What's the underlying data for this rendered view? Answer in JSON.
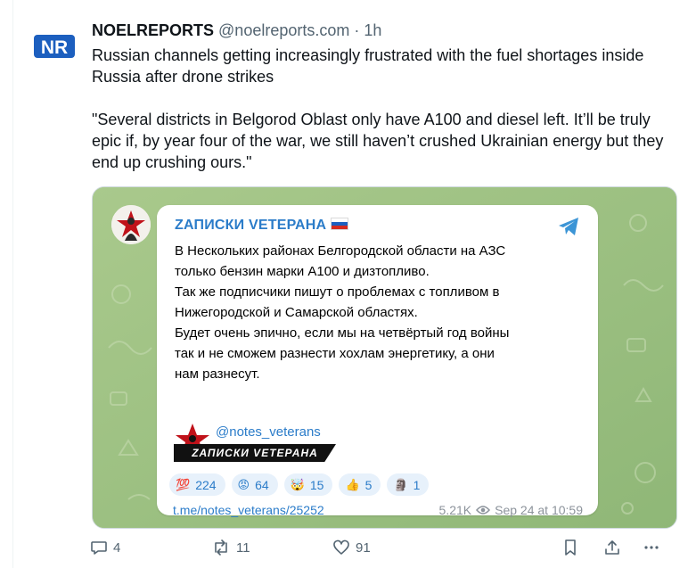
{
  "author": {
    "avatar_text": "NR",
    "name": "NOELREPORTS",
    "handle": "@noelreports.com",
    "separator": "·",
    "time": "1h"
  },
  "tweet": {
    "paragraph1": "Russian channels getting increasingly frustrated with the fuel shortages inside Russia after drone strikes",
    "paragraph2": "\"Several districts in Belgorod Oblast only have A100 and diesel left. It’ll be truly epic if, by year four of the war, we still haven’t crushed Ukrainian energy but they end up crushing ours.\""
  },
  "telegram": {
    "channel_name": "ZАПИСКИ VЕТЕРАНА",
    "text": "В Нескольких районах Белгородской области на АЗС\nтолько бензин марки А100 и дизтопливо.\nТак же подписчики пишут о проблемах с топливом в\nНижегородской и Самарской областях.\nБудет очень эпично, если мы на четвёртый год войны\nтак и не сможем разнести хохлам энергетику, а они\nнам разнесут.",
    "signature_handle": "@notes_veterans",
    "signature_banner": "ZАПИСКИ VЕТЕРАНА",
    "reactions": [
      {
        "emoji": "💯",
        "icon": "hundred-points-icon",
        "count": "224"
      },
      {
        "emoji": "😡",
        "icon": "angry-face-icon",
        "count": "64"
      },
      {
        "emoji": "🤯",
        "icon": "exploding-head-icon",
        "count": "15"
      },
      {
        "emoji": "👍",
        "icon": "thumbs-up-icon",
        "count": "5"
      },
      {
        "emoji": "🗿",
        "icon": "sticker-icon",
        "count": "1"
      }
    ],
    "link": "t.me/notes_veterans/25252",
    "views": "5.21K",
    "date": "Sep 24 at 10:59",
    "accent_color": "#2b7cc9",
    "background_color": "#9bbf82"
  },
  "actions": {
    "replies": "4",
    "reposts": "11",
    "likes": "91"
  },
  "colors": {
    "brand_blue": "#1c5fbf",
    "text_secondary": "#536471"
  }
}
